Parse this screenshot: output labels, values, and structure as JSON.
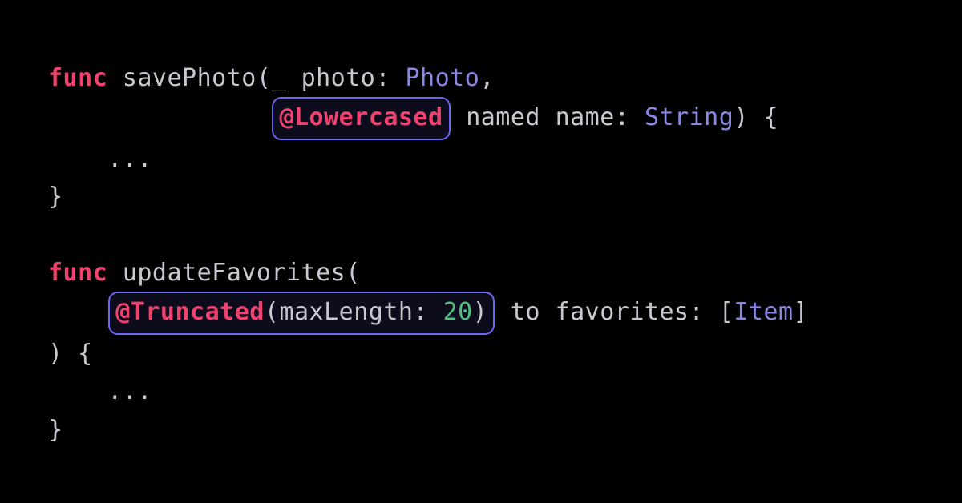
{
  "code": {
    "line1": {
      "func": "func",
      "sp": " ",
      "name": "savePhoto",
      "open": "(",
      "us": "_",
      "sp2": " ",
      "arg1": "photo",
      "colon": ":",
      "sp3": " ",
      "type1": "Photo",
      "comma": ","
    },
    "line2": {
      "indent": "               ",
      "hl_at": "@",
      "hl_name": "Lowercased",
      "sp": " ",
      "label": "named",
      "sp2": " ",
      "arg": "name",
      "colon": ":",
      "sp3": " ",
      "type": "String",
      "close": ")",
      "sp4": " ",
      "brace": "{"
    },
    "line3": {
      "indent": "    ",
      "dots": "..."
    },
    "line4": {
      "brace": "}"
    },
    "line5": "",
    "line6": {
      "func": "func",
      "sp": " ",
      "name": "updateFavorites",
      "open": "("
    },
    "line7": {
      "indent": "    ",
      "hl_at": "@",
      "hl_name": "Truncated",
      "hl_open": "(",
      "hl_arg": "maxLength",
      "hl_colon": ":",
      "hl_sp": " ",
      "hl_num": "20",
      "hl_close": ")",
      "sp": " ",
      "label": "to",
      "sp2": " ",
      "arg": "favorites",
      "colon": ":",
      "sp3": " ",
      "br_open": "[",
      "type": "Item",
      "br_close": "]"
    },
    "line8": {
      "close": ")",
      "sp": " ",
      "brace": "{"
    },
    "line9": {
      "indent": "    ",
      "dots": "..."
    },
    "line10": {
      "brace": "}"
    }
  }
}
